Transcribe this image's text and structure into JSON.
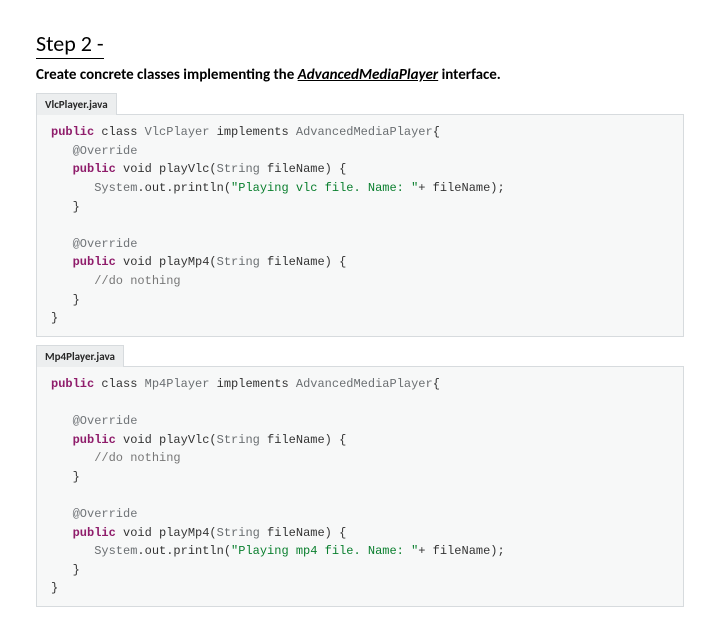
{
  "step": {
    "title": "Step 2 -",
    "desc_pre": "Create concrete classes implementing the ",
    "desc_link": "AdvancedMediaPlayer",
    "desc_post": " interface."
  },
  "files": [
    {
      "header": "VlcPlayer.java",
      "code": {
        "l1a": "public",
        "l1b": " class ",
        "l1c": "VlcPlayer",
        "l1d": " implements ",
        "l1e": "AdvancedMediaPlayer",
        "l1f": "{",
        "l2": "   @Override",
        "l3a": "   public",
        "l3b": " void playVlc(",
        "l3c": "String",
        "l3d": " fileName) {",
        "l4a": "      System",
        "l4b": ".out.println(",
        "l4c": "\"Playing vlc file. Name: \"",
        "l4d": "+ fileName);",
        "l5": "   }",
        "l6": "",
        "l7": "   @Override",
        "l8a": "   public",
        "l8b": " void playMp4(",
        "l8c": "String",
        "l8d": " fileName) {",
        "l9": "      //do nothing",
        "l10": "   }",
        "l11": "}"
      }
    },
    {
      "header": "Mp4Player.java",
      "code": {
        "l1a": "public",
        "l1b": " class ",
        "l1c": "Mp4Player",
        "l1d": " implements ",
        "l1e": "AdvancedMediaPlayer",
        "l1f": "{",
        "l2": "",
        "l3": "   @Override",
        "l4a": "   public",
        "l4b": " void playVlc(",
        "l4c": "String",
        "l4d": " fileName) {",
        "l5": "      //do nothing",
        "l6": "   }",
        "l7": "",
        "l8": "   @Override",
        "l9a": "   public",
        "l9b": " void playMp4(",
        "l9c": "String",
        "l9d": " fileName) {",
        "l10a": "      System",
        "l10b": ".out.println(",
        "l10c": "\"Playing mp4 file. Name: \"",
        "l10d": "+ fileName);",
        "l11": "   }",
        "l12": "}"
      }
    }
  ]
}
